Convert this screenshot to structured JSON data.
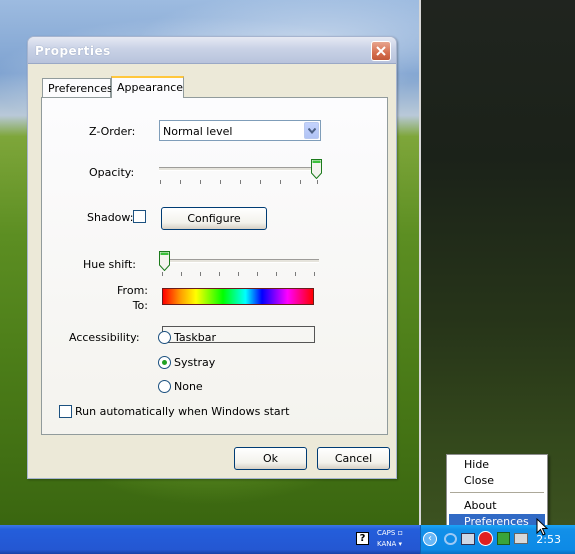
{
  "dialog": {
    "title": "Properties",
    "tabs": [
      {
        "label": "Preferences",
        "active": false
      },
      {
        "label": "Appearance",
        "active": true
      }
    ],
    "zorder": {
      "label": "Z-Order:",
      "value": "Normal level"
    },
    "opacity": {
      "label": "Opacity:",
      "value_fraction": 1.0
    },
    "shadow": {
      "label": "Shadow:",
      "checked": false,
      "configure_label": "Configure"
    },
    "hue": {
      "label": "Hue shift:",
      "value_fraction": 0.0,
      "from_label": "From:",
      "to_label": "To:"
    },
    "accessibility": {
      "label": "Accessibility:",
      "options": [
        "Taskbar",
        "Systray",
        "None"
      ],
      "selected": "Systray"
    },
    "autorun": {
      "label": "Run automatically when Windows start",
      "checked": false
    },
    "ok_label": "Ok",
    "cancel_label": "Cancel"
  },
  "context_menu": {
    "items": [
      "Hide",
      "Close",
      "About",
      "Preferences"
    ],
    "highlighted": "Preferences"
  },
  "taskbar": {
    "caps_label": "CAPS",
    "kana_label": "KANA",
    "clock": "2:53"
  },
  "colors": {
    "selection": "#316ac5",
    "taskbar": "#245edb",
    "tray": "#0f8ae6"
  }
}
